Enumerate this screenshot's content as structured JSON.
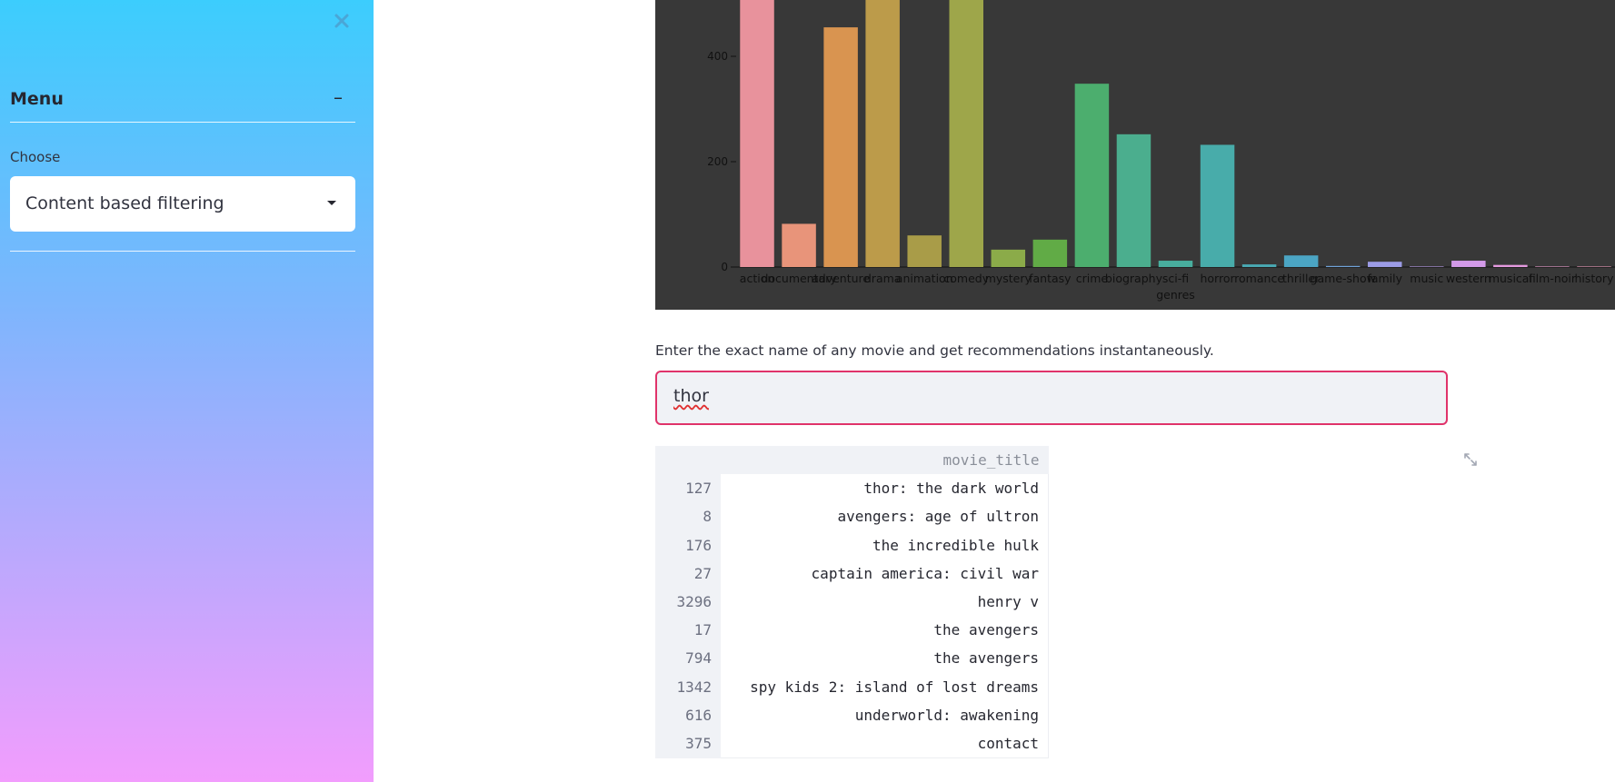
{
  "sidebar": {
    "menu_title": "Menu",
    "collapse_symbol": "–",
    "choose_label": "Choose",
    "selected_option": "Content based filtering",
    "close_icon": "close-icon",
    "caret_icon": "caret-down-icon"
  },
  "chart_data": {
    "type": "bar",
    "xlabel": "genres",
    "categories": [
      "action",
      "documentary",
      "adventure",
      "drama",
      "animation",
      "comedy",
      "mystery",
      "fantasy",
      "crime",
      "biography",
      "sci-fi",
      "horror",
      "romance",
      "thriller",
      "game-show",
      "family",
      "music",
      "western",
      "musical",
      "film-noir",
      "history"
    ],
    "values": [
      560,
      82,
      455,
      560,
      60,
      560,
      33,
      52,
      348,
      252,
      12,
      232,
      5,
      22,
      2,
      10,
      1,
      12,
      4,
      1,
      1
    ],
    "colors": [
      "#e8929c",
      "#e8947a",
      "#d99450",
      "#bc9b4a",
      "#a99c48",
      "#9ea64a",
      "#8bab49",
      "#61ab46",
      "#4cae6e",
      "#4bae8e",
      "#48ae9e",
      "#48acaa",
      "#49a9b3",
      "#4ba5c4",
      "#70a2d8",
      "#9c9ce6",
      "#b79ae9",
      "#d39ae9",
      "#e59ae0",
      "#e89acc",
      "#e897b6"
    ],
    "yticks": [
      0,
      200,
      400
    ],
    "ylim": [
      0,
      500
    ],
    "background": "#383838",
    "grid": false
  },
  "main": {
    "instruction": "Enter the exact name of any movie and get recommendations instantaneously.",
    "input_value": "thor",
    "expand_icon": "expand-icon"
  },
  "table": {
    "header": "movie_title",
    "rows": [
      {
        "index": "127",
        "title": "thor: the dark world"
      },
      {
        "index": "8",
        "title": "avengers: age of ultron"
      },
      {
        "index": "176",
        "title": "the incredible hulk"
      },
      {
        "index": "27",
        "title": "captain america: civil war"
      },
      {
        "index": "3296",
        "title": "henry v"
      },
      {
        "index": "17",
        "title": "the avengers"
      },
      {
        "index": "794",
        "title": "the avengers"
      },
      {
        "index": "1342",
        "title": "spy kids 2: island of lost dreams"
      },
      {
        "index": "616",
        "title": "underworld: awakening"
      },
      {
        "index": "375",
        "title": "contact"
      }
    ]
  }
}
